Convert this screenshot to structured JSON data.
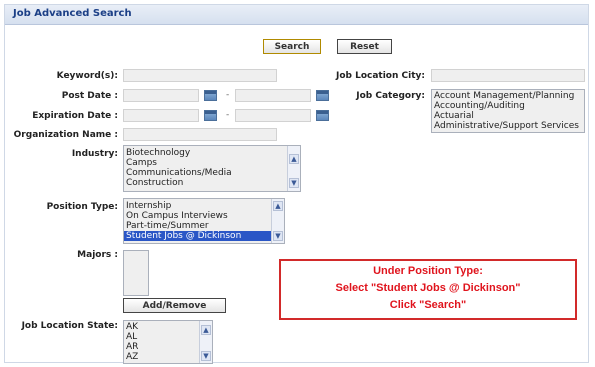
{
  "panel": {
    "title": "Job Advanced Search"
  },
  "buttons": {
    "search": "Search",
    "reset": "Reset",
    "add_remove": "Add/Remove"
  },
  "fields": {
    "keywords_label": "Keyword(s):",
    "post_date_label": "Post Date :",
    "expiration_date_label": "Expiration Date :",
    "organization_label": "Organization Name :",
    "industry_label": "Industry:",
    "position_type_label": "Position Type:",
    "majors_label": "Majors :",
    "job_location_state_label": "Job Location State:",
    "job_location_city_label": "Job Location City:",
    "job_category_label": "Job Category:",
    "date_separator": "-"
  },
  "industry_options": [
    "Biotechnology",
    "Camps",
    "Communications/Media",
    "Construction"
  ],
  "position_type_options": [
    "Internship",
    "On Campus Interviews",
    "Part-time/Summer",
    "Student Jobs @ Dickinson"
  ],
  "position_type_selected": "Student Jobs @ Dickinson",
  "state_options": [
    "AK",
    "AL",
    "AR",
    "AZ"
  ],
  "job_category_options": [
    "Account Management/Planning",
    "Accounting/Auditing",
    "Actuarial",
    "Administrative/Support Services"
  ],
  "callout": {
    "line1": "Under Position Type:",
    "line2": "Select \"Student Jobs @ Dickinson\"",
    "line3": "Click \"Search\""
  },
  "icons": {
    "calendar": "calendar-icon",
    "scroll_up": "chevron-up-icon",
    "scroll_down": "chevron-down-icon"
  },
  "colors": {
    "title": "#1b3f86",
    "selection": "#2a56c6",
    "callout": "#e0141d"
  }
}
